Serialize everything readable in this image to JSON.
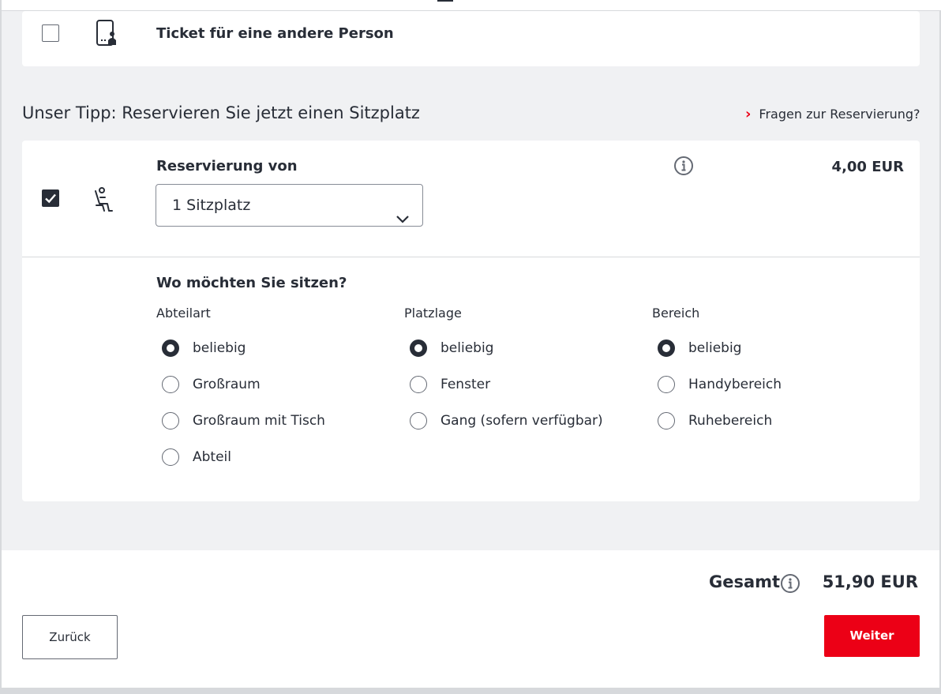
{
  "other_person": {
    "checked": false,
    "label": "Ticket für eine andere Person",
    "icon": "phone-person-icon"
  },
  "tipp": {
    "heading": "Unser Tipp: Reservieren Sie jetzt einen Sitzplatz",
    "faq_link": "Fragen zur Reservierung?",
    "faq_chevron": "›"
  },
  "reservation": {
    "checked": true,
    "icon": "seat-icon",
    "label": "Reservierung von",
    "select_value": "1 Sitzplatz",
    "price": "4,00 EUR",
    "question": "Wo möchten Sie sitzen?",
    "groups": [
      {
        "title": "Abteilart",
        "options": [
          {
            "label": "beliebig",
            "selected": true
          },
          {
            "label": "Großraum",
            "selected": false
          },
          {
            "label": "Großraum mit Tisch",
            "selected": false
          },
          {
            "label": "Abteil",
            "selected": false
          }
        ]
      },
      {
        "title": "Platzlage",
        "options": [
          {
            "label": "beliebig",
            "selected": true
          },
          {
            "label": "Fenster",
            "selected": false
          },
          {
            "label": "Gang (sofern verfügbar)",
            "selected": false
          }
        ]
      },
      {
        "title": "Bereich",
        "options": [
          {
            "label": "beliebig",
            "selected": true
          },
          {
            "label": "Handybereich",
            "selected": false
          },
          {
            "label": "Ruhebereich",
            "selected": false
          }
        ]
      }
    ]
  },
  "footer": {
    "total_label": "Gesamt",
    "total_value": "51,90 EUR",
    "back_label": "Zurück",
    "next_label": "Weiter"
  },
  "colors": {
    "accent_red": "#ec0016",
    "text": "#282d37",
    "background": "#f0f1f3"
  }
}
